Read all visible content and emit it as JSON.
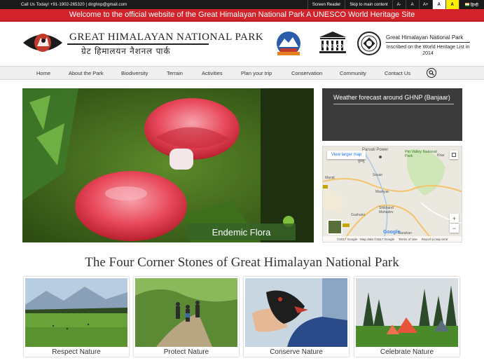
{
  "topbar": {
    "contact": "Call Us Today! +91-1902-265320 | dirghnp@gmail.com",
    "screen_reader": "Screen Reader",
    "skip": "Skip to main content",
    "font_minus": "A-",
    "font_normal": "A",
    "font_plus": "A+",
    "contrast_white": "A",
    "contrast_yellow": "A",
    "lang": "हिन्दी"
  },
  "marquee": {
    "text": "Welcome to the official website of the Great Himalayan National Park A UNESCO World Heritage Site"
  },
  "header": {
    "title": "GREAT HIMALAYAN NATIONAL PARK",
    "title_hindi": "ग्रेट हिमालयन नैशनल पार्क",
    "unesco_title": "Great Himalayan National Park",
    "unesco_sub": "Inscribed on the World Heritage List in 2014"
  },
  "nav": {
    "items": [
      "Home",
      "About the Park",
      "Biodiversity",
      "Terrain",
      "Activities",
      "Plan your trip",
      "Conservation",
      "Community",
      "Contact Us"
    ]
  },
  "hero": {
    "caption": "Endemic Flora"
  },
  "weather": {
    "title": "Weather forecast around GHNP (Banjaar)"
  },
  "map": {
    "view_larger": "View larger map",
    "labels": {
      "parvati": "Parvati Power",
      "pin_valley": "Pin Valley National Park",
      "khar": "Khar",
      "kaza": "Kaza",
      "kullu": "कुल्लु",
      "mandi": "Mandi",
      "sosan": "Sosan",
      "rampur": "Rampur",
      "mashyar": "Mashyar",
      "gushaini": "Gushaini",
      "shikhand": "Shikhand Mahadev",
      "narkanda": "Narkanda",
      "barahan": "Barahan",
      "google": "Google"
    },
    "footer_copy": "©2017 Google - Map data ©2017 Google",
    "footer_terms": "Terms of Use",
    "footer_report": "Report a map error"
  },
  "section": {
    "title": "The Four Corner Stones of Great Himalayan National Park"
  },
  "cards": [
    {
      "label": "Respect Nature"
    },
    {
      "label": "Protect Nature"
    },
    {
      "label": "Conserve Nature"
    },
    {
      "label": "Celebrate Nature"
    }
  ]
}
